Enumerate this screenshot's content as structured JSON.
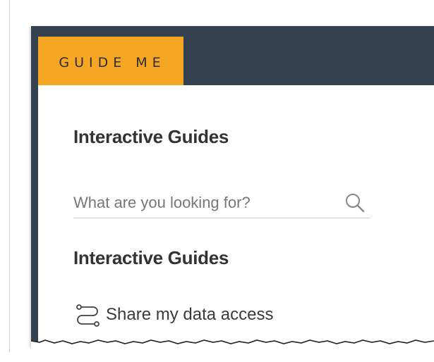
{
  "tab": {
    "label": "GUIDE ME"
  },
  "panel": {
    "heading": "Interactive Guides",
    "search": {
      "placeholder": "What are you looking for?",
      "value": ""
    },
    "list_heading": "Interactive Guides",
    "items": [
      {
        "label": "Share my data access",
        "icon": "route-icon"
      }
    ]
  },
  "colors": {
    "header_bg": "#34414e",
    "tab_bg": "#f5a623",
    "text": "#333333"
  }
}
